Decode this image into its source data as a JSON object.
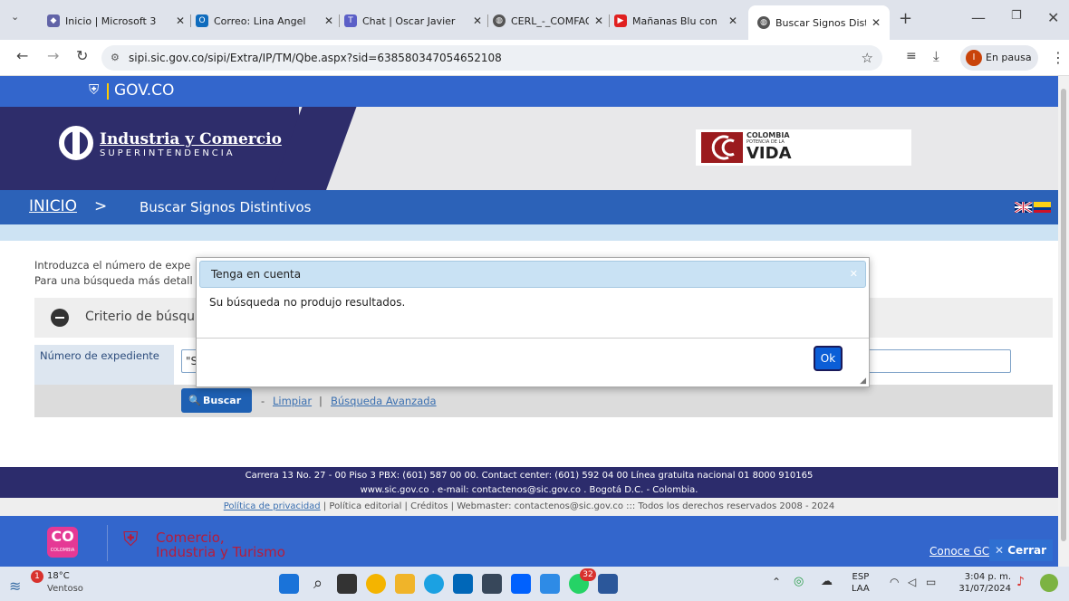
{
  "browser": {
    "tabs": [
      {
        "label": "Inicio | Microsoft 3"
      },
      {
        "label": "Correo: Lina Angel"
      },
      {
        "label": "Chat | Oscar Javier"
      },
      {
        "label": "CERL_-_COMFAOR"
      },
      {
        "label": "Mañanas Blu con"
      },
      {
        "label": "Buscar Signos Dist"
      }
    ],
    "new_tab": "+",
    "url": "sipi.sic.gov.co/sipi/Extra/IP/TM/Qbe.aspx?sid=638580347054652108",
    "profile_label": "En pausa",
    "profile_initial": "I"
  },
  "page": {
    "gov_label": "GOV.CO",
    "sic_name": "Industria y Comercio",
    "sic_sub": "SUPERINTENDENCIA",
    "colombia_top": "COLOMBIA",
    "colombia_mid": "POTENCIA DE LA",
    "colombia_vida": "VIDA",
    "breadcrumb_home": "INICIO",
    "breadcrumb_sep": ">",
    "breadcrumb_title": "Buscar Signos Distintivos",
    "intro_line1": "Introduzca el número de expe",
    "intro_line2": "Para una búsqueda más detall",
    "criteria_label": "Criterio de búsqu",
    "field_label": "Número de expediente",
    "field_value": "\"S",
    "search_button": "Buscar",
    "dash": "-",
    "clear_link": "Limpiar",
    "pipe": "|",
    "advanced_link": "Búsqueda Avanzada",
    "footer_line1": "Carrera 13 No. 27 - 00 Piso 3 PBX: (601) 587 00 00. Contact center: (601) 592 04 00 Línea gratuita nacional 01 8000 910165",
    "footer_line2": "www.sic.gov.co . e-mail: contactenos@sic.gov.co . Bogotá D.C. - Colombia.",
    "footer_privacy": "Política de privacidad",
    "footer_rest": "| Política editorial | Créditos | Webmaster: contactenos@sic.gov.co ::: Todos los derechos reservados 2008 - 2024",
    "mincit_line1": "Comercio,",
    "mincit_line2": "Industria y Turismo",
    "co_badge": "CO",
    "co_badge_sub": "COLOMBIA",
    "conoce": "Conoce GC",
    "close_button": "Cerrar"
  },
  "modal": {
    "title": "Tenga en cuenta",
    "message": "Su búsqueda no produjo resultados.",
    "ok_label": "Ok"
  },
  "taskbar": {
    "temperature": "18°C",
    "weather": "Ventoso",
    "weather_badge": "1",
    "whatsapp_badge": "32",
    "lang1": "ESP",
    "lang2": "LAA",
    "time": "3:04 p. m.",
    "date": "31/07/2024"
  }
}
